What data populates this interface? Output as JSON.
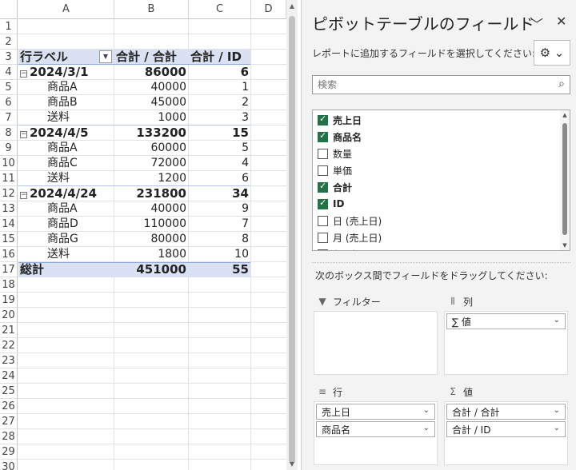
{
  "sheet": {
    "columns": [
      "A",
      "B",
      "C",
      "D"
    ],
    "rows": [
      "1",
      "2",
      "3",
      "4",
      "5",
      "6",
      "7",
      "8",
      "9",
      "10",
      "11",
      "12",
      "13",
      "14",
      "15",
      "16",
      "17",
      "18",
      "19",
      "20",
      "21",
      "22",
      "23",
      "24",
      "25",
      "26",
      "27",
      "28",
      "29",
      "30"
    ],
    "pivot": {
      "header": {
        "row_label": "行ラベル",
        "col_b": "合計 / 合計",
        "col_c": "合計 / ID"
      },
      "groups": [
        {
          "date": "2024/3/1",
          "sum": "86000",
          "id": "6",
          "items": [
            {
              "name": "商品A",
              "sum": "40000",
              "id": "1"
            },
            {
              "name": "商品B",
              "sum": "45000",
              "id": "2"
            },
            {
              "name": "送料",
              "sum": "1000",
              "id": "3"
            }
          ]
        },
        {
          "date": "2024/4/5",
          "sum": "133200",
          "id": "15",
          "items": [
            {
              "name": "商品A",
              "sum": "60000",
              "id": "5"
            },
            {
              "name": "商品C",
              "sum": "72000",
              "id": "4"
            },
            {
              "name": "送料",
              "sum": "1200",
              "id": "6"
            }
          ]
        },
        {
          "date": "2024/4/24",
          "sum": "231800",
          "id": "34",
          "items": [
            {
              "name": "商品A",
              "sum": "40000",
              "id": "9"
            },
            {
              "name": "商品D",
              "sum": "110000",
              "id": "7"
            },
            {
              "name": "商品G",
              "sum": "80000",
              "id": "8"
            },
            {
              "name": "送料",
              "sum": "1800",
              "id": "10"
            }
          ]
        }
      ],
      "total": {
        "label": "総計",
        "sum": "451000",
        "id": "55"
      }
    }
  },
  "pane": {
    "title": "ピボットテーブルのフィールド",
    "collapse_glyph": "﹀",
    "close_glyph": "✕",
    "choose_label": "レポートに追加するフィールドを選択してください:",
    "gear_glyph": "⚙ ⌄",
    "search_placeholder": "検索",
    "search_glyph": "⌕",
    "fields": [
      {
        "label": "売上日",
        "checked": true
      },
      {
        "label": "商品名",
        "checked": true
      },
      {
        "label": "数量",
        "checked": false
      },
      {
        "label": "単価",
        "checked": false
      },
      {
        "label": "合計",
        "checked": true
      },
      {
        "label": "ID",
        "checked": true
      },
      {
        "label": "日 (売上日)",
        "checked": false
      },
      {
        "label": "月 (売上日)",
        "checked": false
      },
      {
        "label": "年 (売上日)",
        "checked": false
      }
    ],
    "drag_label": "次のボックス間でフィールドをドラッグしてください:",
    "areas": {
      "filter": {
        "label": "フィルター",
        "icon": "▼",
        "chips": []
      },
      "columns": {
        "label": "列",
        "icon": "⦀",
        "chips": [
          "∑ 値"
        ]
      },
      "rows": {
        "label": "行",
        "icon": "≡",
        "chips": [
          "売上日",
          "商品名"
        ]
      },
      "values": {
        "label": "値",
        "icon": "Σ",
        "chips": [
          "合計 / 合計",
          "合計 / ID"
        ]
      }
    }
  }
}
